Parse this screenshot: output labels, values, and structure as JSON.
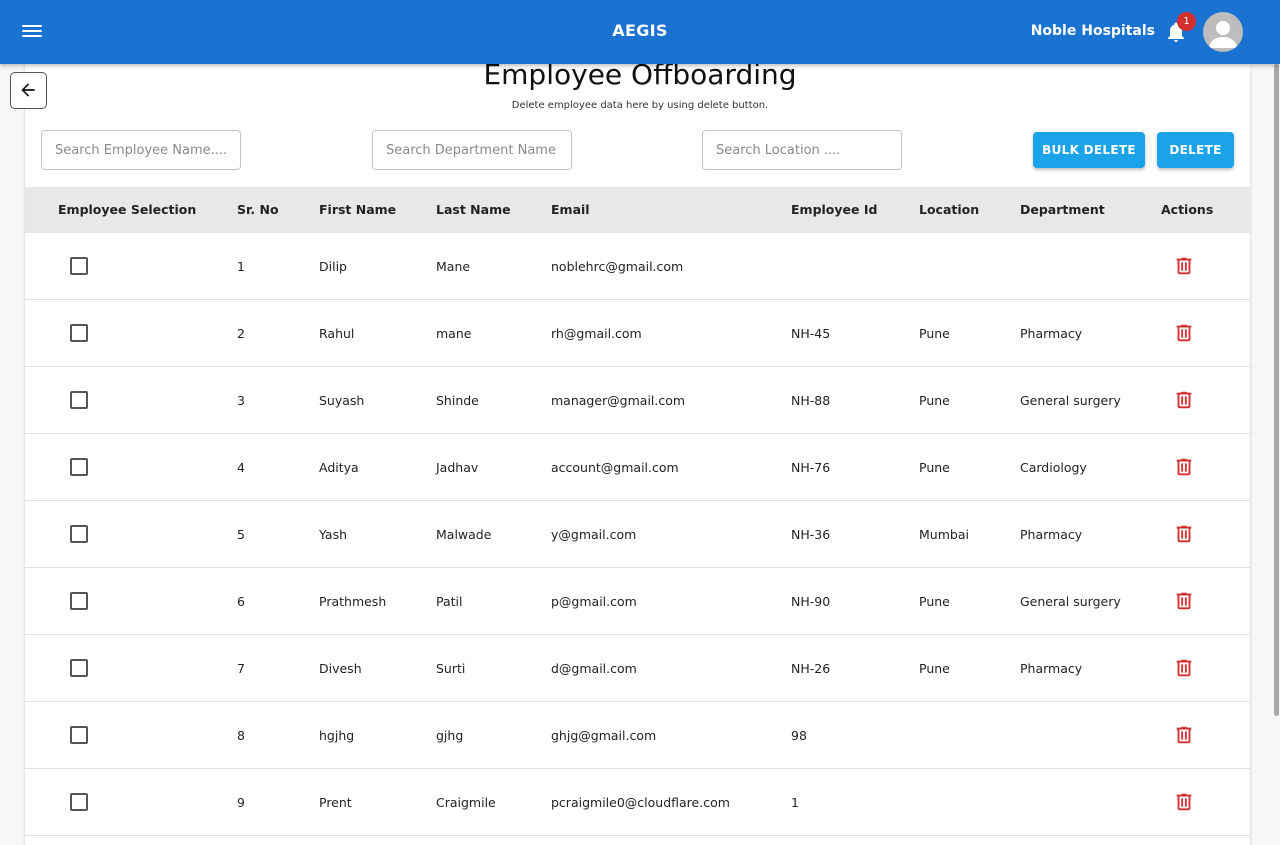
{
  "app": {
    "title": "AEGIS",
    "org_name": "Noble Hospitals",
    "notification_count": "1"
  },
  "page": {
    "title": "Employee Offboarding",
    "subtitle": "Delete employee data here by using delete button."
  },
  "search": {
    "employee_placeholder": "Search Employee Name....",
    "department_placeholder": "Search Department Name",
    "location_placeholder": "Search Location ...."
  },
  "buttons": {
    "bulk_delete": "BULK DELETE",
    "delete": "DELETE"
  },
  "colors": {
    "appbar": "#1a73d0",
    "button": "#1aa3e8",
    "badge": "#d32f2f",
    "delete_icon": "#d32f2f"
  },
  "icons": {
    "menu": "menu-icon",
    "bell": "bell-icon",
    "avatar": "user-avatar-icon",
    "back": "arrow-left-icon",
    "delete": "trash-icon"
  },
  "table": {
    "columns": [
      "Employee Selection",
      "Sr. No",
      "First Name",
      "Last Name",
      "Email",
      "Employee Id",
      "Location",
      "Department",
      "Actions"
    ],
    "rows": [
      {
        "sr": "1",
        "first": "Dilip",
        "last": "Mane",
        "email": "noblehrc@gmail.com",
        "emp_id": "",
        "location": "",
        "department": ""
      },
      {
        "sr": "2",
        "first": "Rahul",
        "last": "mane",
        "email": "rh@gmail.com",
        "emp_id": "NH-45",
        "location": "Pune",
        "department": "Pharmacy"
      },
      {
        "sr": "3",
        "first": "Suyash",
        "last": "Shinde",
        "email": "manager@gmail.com",
        "emp_id": "NH-88",
        "location": "Pune",
        "department": "General surgery"
      },
      {
        "sr": "4",
        "first": "Aditya",
        "last": "Jadhav",
        "email": "account@gmail.com",
        "emp_id": "NH-76",
        "location": "Pune",
        "department": "Cardiology"
      },
      {
        "sr": "5",
        "first": "Yash",
        "last": "Malwade",
        "email": "y@gmail.com",
        "emp_id": "NH-36",
        "location": "Mumbai",
        "department": "Pharmacy"
      },
      {
        "sr": "6",
        "first": "Prathmesh",
        "last": "Patil",
        "email": "p@gmail.com",
        "emp_id": "NH-90",
        "location": "Pune",
        "department": "General surgery"
      },
      {
        "sr": "7",
        "first": "Divesh",
        "last": "Surti",
        "email": "d@gmail.com",
        "emp_id": "NH-26",
        "location": "Pune",
        "department": "Pharmacy"
      },
      {
        "sr": "8",
        "first": "hgjhg",
        "last": "gjhg",
        "email": "ghjg@gmail.com",
        "emp_id": "98",
        "location": "",
        "department": ""
      },
      {
        "sr": "9",
        "first": "Prent",
        "last": "Craigmile",
        "email": "pcraigmile0@cloudflare.com",
        "emp_id": "1",
        "location": "",
        "department": ""
      }
    ]
  }
}
